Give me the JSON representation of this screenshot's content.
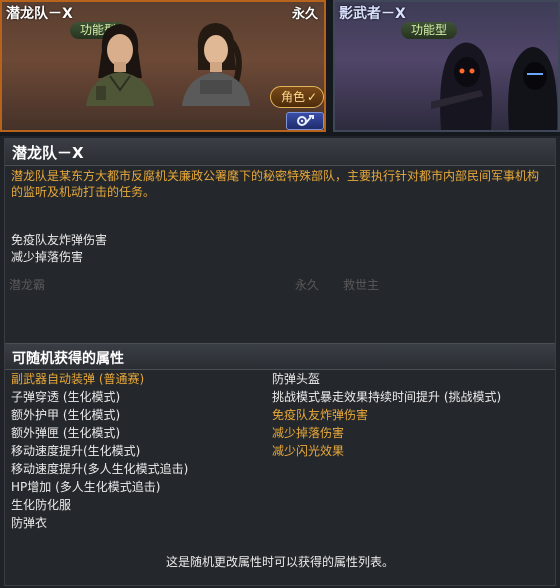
{
  "cards": [
    {
      "name": "潜龙队－X",
      "type": "功能型",
      "flag": "永久",
      "selected": true
    },
    {
      "name": "影武者－X",
      "type": "功能型",
      "flag": "",
      "selected": false
    }
  ],
  "role_button": {
    "label": "角色",
    "check": "✓"
  },
  "tool_button": {
    "icon": "wrench-gear-icon"
  },
  "detail": {
    "title": "潜龙队－X",
    "description": "潜龙队是某东方大都市反腐机关廉政公署麾下的秘密特殊部队，主要执行针对都市内部民间军事机构的监听及机动打击的任务。",
    "features": [
      "免疫队友炸弹伤害",
      "减少掉落伤害"
    ],
    "ghost_labels": [
      "潜龙霸",
      "永久",
      "救世主"
    ]
  },
  "attributes": {
    "title": "可随机获得的属性",
    "left": [
      {
        "text": "副武器自动装弹 (普通赛)",
        "highlight": true
      },
      {
        "text": "子弹穿透 (生化模式)",
        "highlight": false
      },
      {
        "text": "额外护甲 (生化模式)",
        "highlight": false
      },
      {
        "text": "额外弹匣 (生化模式)",
        "highlight": false
      },
      {
        "text": "移动速度提升(生化模式)",
        "highlight": false
      },
      {
        "text": "移动速度提升(多人生化模式追击)",
        "highlight": false
      },
      {
        "text": "HP增加 (多人生化模式追击)",
        "highlight": false
      },
      {
        "text": "生化防化服",
        "highlight": false
      },
      {
        "text": "防弹衣",
        "highlight": false
      }
    ],
    "right": [
      {
        "text": "防弹头盔",
        "highlight": false
      },
      {
        "text": "挑战模式暴走效果持续时间提升 (挑战模式)",
        "highlight": false
      },
      {
        "text": "免疫队友炸弹伤害",
        "highlight": true
      },
      {
        "text": "减少掉落伤害",
        "highlight": true
      },
      {
        "text": "减少闪光效果",
        "highlight": true
      }
    ],
    "footer": "这是随机更改属性时可以获得的属性列表。"
  },
  "colors": {
    "selected_border": "#b8631c",
    "highlight_text": "#e8a93a"
  }
}
